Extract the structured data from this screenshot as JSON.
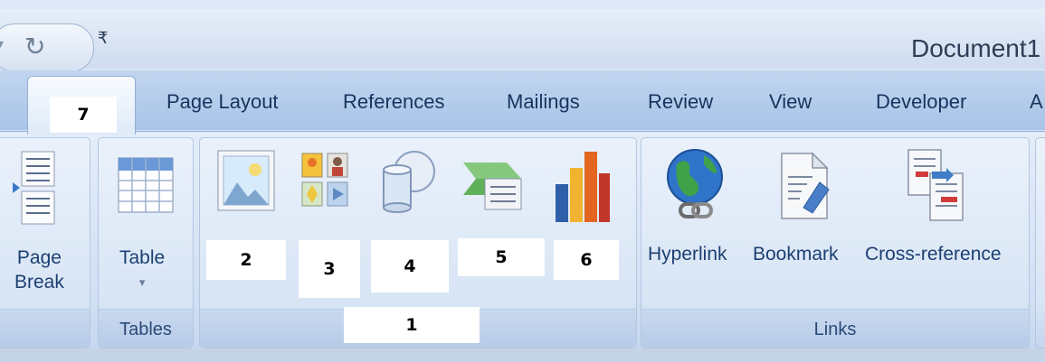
{
  "quick_access": {
    "undo_arrow": "▾",
    "redo_icon": "redo-icon",
    "customize_glyph": "₹"
  },
  "title": "Document1 -",
  "tabs": {
    "active_label": "7",
    "items": [
      "Page Layout",
      "References",
      "Mailings",
      "Review",
      "View",
      "Developer",
      "A"
    ]
  },
  "groups": {
    "pages": {
      "page_break_line1": "Page",
      "page_break_line2": "Break"
    },
    "tables": {
      "table_label": "Table",
      "dropdown": "▾",
      "group_label": "Tables"
    },
    "illustrations": {
      "group_label": "1",
      "box_labels": [
        "2",
        "3",
        "4",
        "5",
        "6"
      ]
    },
    "links": {
      "hyperlink": "Hyperlink",
      "bookmark": "Bookmark",
      "cross_reference": "Cross-reference",
      "group_label": "Links"
    }
  },
  "colors": {
    "label_text": "#1c3f72",
    "ribbon_bg": "#dbe6f5"
  }
}
